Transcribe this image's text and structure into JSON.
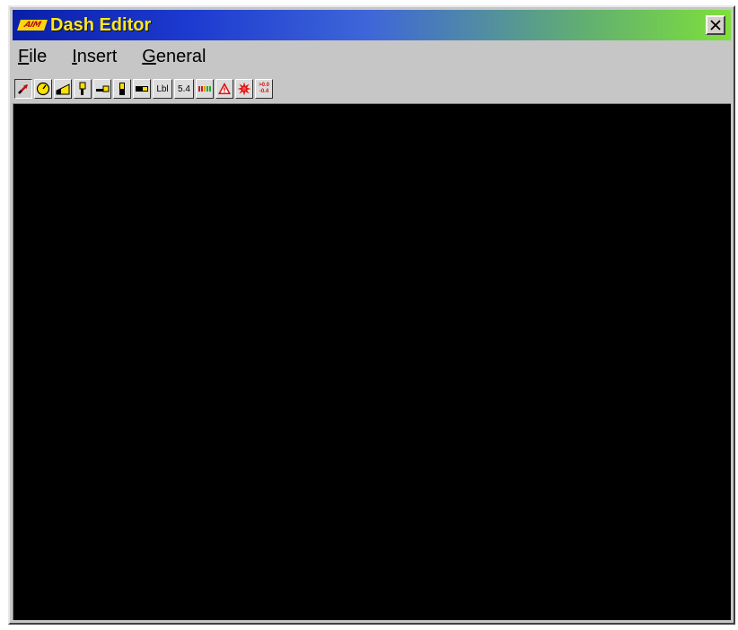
{
  "window": {
    "title": "Dash Editor",
    "logo_text": "AIM",
    "close_symbol": "✕"
  },
  "menu": {
    "items": [
      {
        "label": "File",
        "mnemonic": "F",
        "rest": "ile"
      },
      {
        "label": "Insert",
        "mnemonic": "I",
        "rest": "nsert"
      },
      {
        "label": "General",
        "mnemonic": "G",
        "rest": "eneral"
      }
    ]
  },
  "toolbar": {
    "buttons": [
      {
        "icon": "pointer-icon"
      },
      {
        "icon": "gauge-icon"
      },
      {
        "icon": "bar-graph-icon"
      },
      {
        "icon": "vertical-bar-icon"
      },
      {
        "icon": "horizontal-bar-icon"
      },
      {
        "icon": "vertical-bar-2-icon"
      },
      {
        "icon": "horizontal-bar-2-icon"
      },
      {
        "icon": "label-icon",
        "text": "Lbl"
      },
      {
        "icon": "numeric-icon",
        "text": "5.4"
      },
      {
        "icon": "led-bar-icon"
      },
      {
        "icon": "warning-icon"
      },
      {
        "icon": "light-icon"
      },
      {
        "icon": "lap-time-icon",
        "text_top": ">0.0",
        "text_bottom": "-0.4"
      }
    ]
  },
  "colors": {
    "title_text": "#ffe81a",
    "canvas": "#000000",
    "logo_bg": "#ffd60a",
    "logo_text": "#b01010"
  }
}
